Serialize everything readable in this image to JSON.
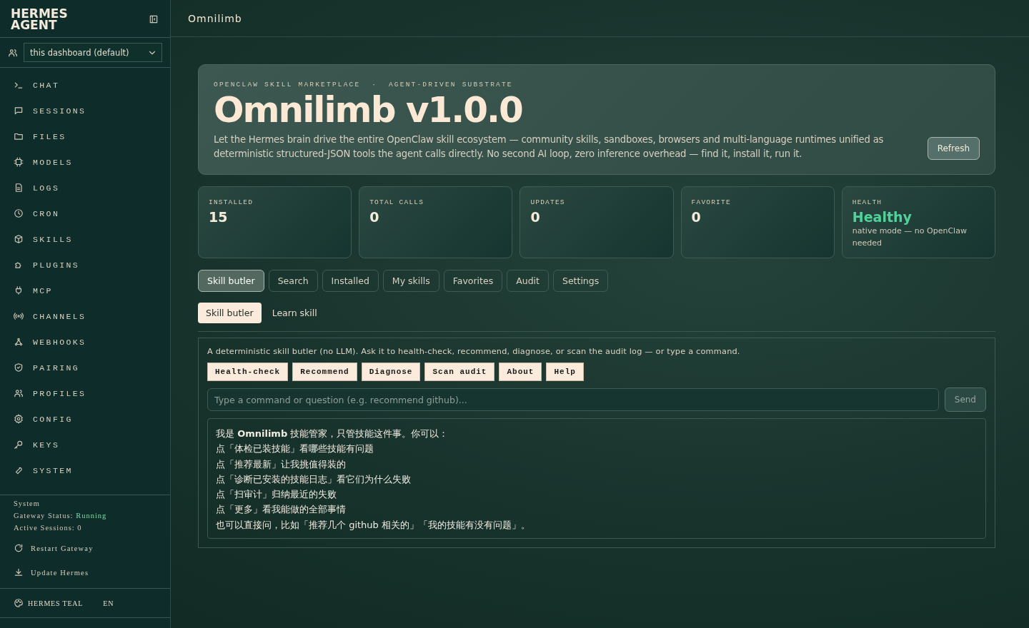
{
  "sidebar": {
    "brand": "HERMES AGENT",
    "profile_select": {
      "value": "this dashboard (default)"
    },
    "nav": [
      {
        "label": "CHAT",
        "selected": false
      },
      {
        "label": "SESSIONS",
        "selected": false
      },
      {
        "label": "FILES",
        "selected": false
      },
      {
        "label": "MODELS",
        "selected": false
      },
      {
        "label": "LOGS",
        "selected": false
      },
      {
        "label": "CRON",
        "selected": false
      },
      {
        "label": "SKILLS",
        "selected": false
      },
      {
        "label": "PLUGINS",
        "selected": false
      },
      {
        "label": "MCP",
        "selected": false
      },
      {
        "label": "CHANNELS",
        "selected": false
      },
      {
        "label": "WEBHOOKS",
        "selected": false
      },
      {
        "label": "PAIRING",
        "selected": false
      },
      {
        "label": "PROFILES",
        "selected": false
      },
      {
        "label": "CONFIG",
        "selected": false
      },
      {
        "label": "KEYS",
        "selected": false
      },
      {
        "label": "SYSTEM",
        "selected": false
      }
    ],
    "system": {
      "title": "System",
      "gateway_label": "Gateway Status:",
      "gateway_status": "Running",
      "sessions": "Active Sessions: 0"
    },
    "actions": [
      "Restart Gateway",
      "Update Hermes"
    ],
    "theme": "HERMES TEAL",
    "language": "EN"
  },
  "header": {
    "title": "Omnilimb"
  },
  "hero": {
    "eyebrow": "OPENCLAW SKILL MARKETPLACE  ·  AGENT-DRIVEN SUBSTRATE",
    "title": "Omnilimb v1.0.0",
    "description": "Let the Hermes brain drive the entire OpenClaw skill ecosystem — community skills, sandboxes, browsers and multi-language runtimes unified as deterministic structured-JSON tools the agent calls directly. No second AI loop, zero inference overhead — find it, install it, run it.",
    "button": "Refresh"
  },
  "stats": [
    {
      "kind": "number",
      "label": "INSTALLED",
      "value": "15"
    },
    {
      "kind": "number",
      "label": "TOTAL CALLS",
      "value": "0"
    },
    {
      "kind": "number",
      "label": "UPDATES",
      "value": "0"
    },
    {
      "kind": "number",
      "label": "FAVORITE",
      "value": "0"
    },
    {
      "kind": "status",
      "label": "HEALTH",
      "value": "Healthy",
      "note": "native mode — no OpenClaw needed"
    }
  ],
  "tabs": [
    {
      "label": "Skill butler",
      "selected": true
    },
    {
      "label": "Search",
      "selected": false
    },
    {
      "label": "Installed",
      "selected": false
    },
    {
      "label": "My skills",
      "selected": false
    },
    {
      "label": "Favorites",
      "selected": false
    },
    {
      "label": "Audit",
      "selected": false
    },
    {
      "label": "Settings",
      "selected": false
    }
  ],
  "subtabs": [
    {
      "label": "Skill butler",
      "selected": true
    },
    {
      "label": "Learn skill",
      "selected": false
    }
  ],
  "butler": {
    "intro": "A deterministic skill butler (no LLM). Ask it to health-check, recommend, diagnose, or scan the audit log — or type a command.",
    "quick_actions": [
      "Health-check",
      "Recommend",
      "Diagnose",
      "Scan audit",
      "About",
      "Help"
    ],
    "input": {
      "placeholder": "Type a command or question (e.g. recommend github)..."
    },
    "send": "Send",
    "reply": [
      "我是 **Omnilimb** 技能管家，只管技能这件事。你可以：",
      "点「体检已装技能」看哪些技能有问题",
      "点「推荐最新」让我挑值得装的",
      "点「诊断已安装的技能日志」看它们为什么失败",
      "点「扫审计」归纳最近的失败",
      "点「更多」看我能做的全部事情",
      "也可以直接问，比如「推荐几个 github 相关的」「我的技能有没有问题」。"
    ]
  }
}
